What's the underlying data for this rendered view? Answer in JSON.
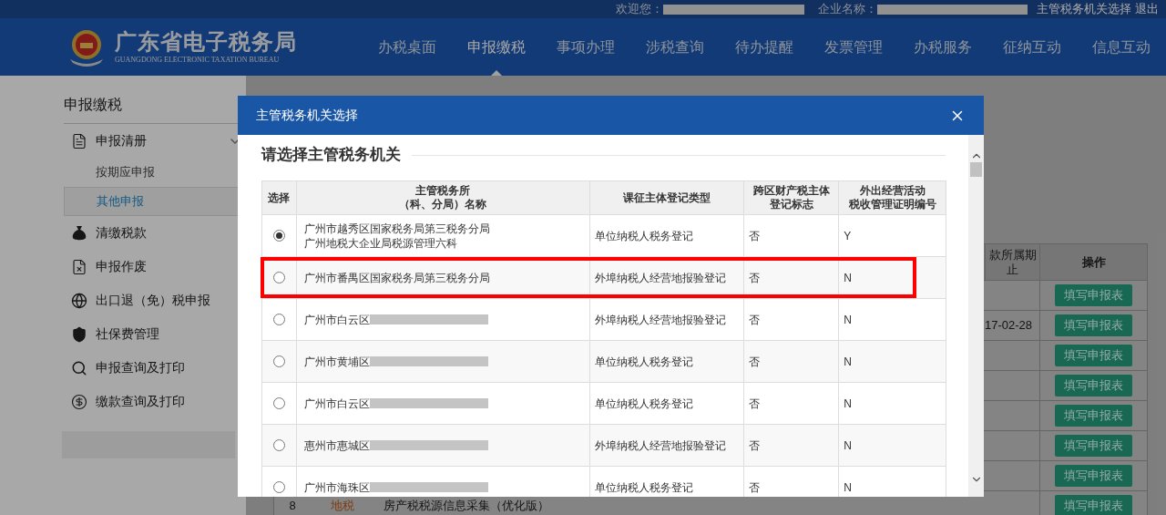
{
  "top_bar": {
    "welcome_label": "欢迎您：",
    "company_label": "企业名称：",
    "links": [
      "主管税务机关选择",
      "退出"
    ]
  },
  "header": {
    "title": "广东省电子税务局",
    "subtitle": "GUANGDONG ELECTRONIC TAXATION BUREAU",
    "nav": [
      {
        "label": "办税桌面",
        "selected": false
      },
      {
        "label": "申报缴税",
        "selected": true
      },
      {
        "label": "事项办理",
        "selected": false
      },
      {
        "label": "涉税查询",
        "selected": false
      },
      {
        "label": "待办提醒",
        "selected": false
      },
      {
        "label": "发票管理",
        "selected": false
      },
      {
        "label": "办税服务",
        "selected": false
      },
      {
        "label": "征纳互动",
        "selected": false
      },
      {
        "label": "信息互动",
        "selected": false
      }
    ]
  },
  "sidebar": {
    "title": "申报缴税",
    "items": [
      {
        "label": "申报清册",
        "expanded": true,
        "children": [
          {
            "label": "按期应申报",
            "selected": false
          },
          {
            "label": "其他申报",
            "selected": true
          }
        ]
      },
      {
        "label": "清缴税款",
        "expanded": false
      },
      {
        "label": "申报作废",
        "expanded": false
      },
      {
        "label": "出口退（免）税申报",
        "expanded": false
      },
      {
        "label": "社保费管理",
        "expanded": false
      },
      {
        "label": "申报查询及打印",
        "expanded": false
      },
      {
        "label": "缴款查询及打印",
        "expanded": false
      }
    ],
    "redacted_entry": true
  },
  "background_table": {
    "columns": [
      "款所属期止",
      "操作"
    ],
    "rows": [
      {
        "action": "填写申报表"
      },
      {
        "period": "17-02-28",
        "action": "填写申报表"
      },
      {
        "action": "填写申报表"
      },
      {
        "action": "填写申报表"
      },
      {
        "action": "填写申报表"
      },
      {
        "action": "填写申报表"
      },
      {
        "action": "填写申报表"
      },
      {
        "column_1": "8",
        "column_2": "地税",
        "column_3": "房产税税源信息采集（优化版）",
        "action": "填写申报表"
      }
    ]
  },
  "dialog": {
    "title": "主管税务机关选择",
    "heading": "请选择主管税务机关",
    "table": {
      "columns": [
        {
          "lines": [
            "选择"
          ]
        },
        {
          "lines": [
            "主管税务所",
            "（科、分局）名称"
          ]
        },
        {
          "lines": [
            "课征主体登记类型"
          ]
        },
        {
          "lines": [
            "跨区财产税主体",
            "登记标志"
          ]
        },
        {
          "lines": [
            "外出经营活动",
            "税收管理证明编号"
          ]
        }
      ],
      "rows": [
        {
          "selected": true,
          "highlighted": false,
          "office": [
            "广州市越秀区国家税务局第三税务分局",
            "广州地税大企业局税源管理六科"
          ],
          "redacted": false,
          "type": "单位纳税人税务登记",
          "cross_region": "否",
          "certificate": "Y"
        },
        {
          "selected": false,
          "highlighted": true,
          "office": [
            "广州市番禺区国家税务局第三税务分局"
          ],
          "redacted": false,
          "type": "外埠纳税人经营地报验登记",
          "cross_region": "否",
          "certificate": "N"
        },
        {
          "selected": false,
          "highlighted": false,
          "office": [
            "广州市白云区"
          ],
          "redacted": true,
          "type": "外埠纳税人经营地报验登记",
          "cross_region": "否",
          "certificate": "N"
        },
        {
          "selected": false,
          "highlighted": false,
          "office": [
            "广州市黄埔区"
          ],
          "redacted": true,
          "type": "单位纳税人税务登记",
          "cross_region": "否",
          "certificate": "N"
        },
        {
          "selected": false,
          "highlighted": false,
          "office": [
            "广州市白云区"
          ],
          "redacted": true,
          "type": "单位纳税人税务登记",
          "cross_region": "否",
          "certificate": "N"
        },
        {
          "selected": false,
          "highlighted": false,
          "office": [
            "惠州市惠城区"
          ],
          "redacted": true,
          "type": "外埠纳税人经营地报验登记",
          "cross_region": "否",
          "certificate": "N"
        },
        {
          "selected": false,
          "highlighted": false,
          "office": [
            "广州市海珠区"
          ],
          "redacted": true,
          "type": "单位纳税人税务登记",
          "cross_region": "否",
          "certificate": "N"
        }
      ]
    }
  }
}
